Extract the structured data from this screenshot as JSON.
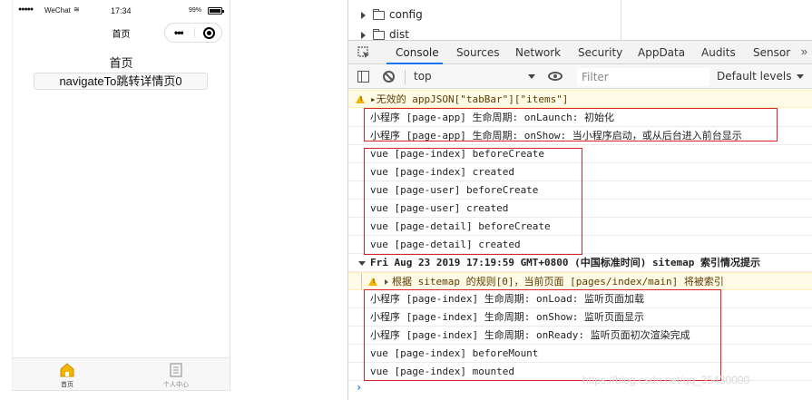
{
  "simulator": {
    "status_bar": {
      "signal": "●●●●●",
      "carrier": "WeChat",
      "wifi": "≋",
      "time": "17:34",
      "battery": "99%"
    },
    "nav_title": "首页",
    "capsule": {
      "more": "•••"
    },
    "page": {
      "title": "首页",
      "button_label": "navigateTo跳转详情页0"
    },
    "tabbar": [
      {
        "label": "首页",
        "icon": "home-icon"
      },
      {
        "label": "个人中心",
        "icon": "document-icon"
      }
    ]
  },
  "devtools": {
    "file_tree": [
      {
        "name": "config"
      },
      {
        "name": "dist"
      }
    ],
    "tabs": [
      "Console",
      "Sources",
      "Network",
      "Security",
      "AppData",
      "Audits",
      "Sensor"
    ],
    "active_tab": "Console",
    "tabs_more": "»",
    "context": "top",
    "filter_placeholder": "Filter",
    "levels_label": "Default levels",
    "accent_color": "#1a73e8",
    "warning_color": "#f2b600",
    "highlight_color": "#d9262b",
    "logs": [
      {
        "type": "warn",
        "text": "▸无效的 appJSON[\"tabBar\"][\"items\"]"
      },
      {
        "type": "log",
        "text": "小程序 [page-app] 生命周期: onLaunch: 初始化"
      },
      {
        "type": "log",
        "text": "小程序 [page-app] 生命周期: onShow: 当小程序启动，或从后台进入前台显示"
      },
      {
        "type": "log",
        "text": "vue [page-index] beforeCreate"
      },
      {
        "type": "log",
        "text": "vue [page-index] created"
      },
      {
        "type": "log",
        "text": "vue [page-user] beforeCreate"
      },
      {
        "type": "log",
        "text": "vue [page-user] created"
      },
      {
        "type": "log",
        "text": "vue [page-detail] beforeCreate"
      },
      {
        "type": "log",
        "text": "vue [page-detail] created"
      },
      {
        "type": "group",
        "text": "Fri Aug 23 2019 17:19:59 GMT+0800 (中国标准时间) sitemap 索引情况提示"
      },
      {
        "type": "warn-nested",
        "text": "根据 sitemap 的规则[0]，当前页面 [pages/index/main] 将被索引"
      },
      {
        "type": "log",
        "text": "小程序 [page-index] 生命周期: onLoad: 监听页面加载"
      },
      {
        "type": "log",
        "text": "小程序 [page-index] 生命周期: onShow: 监听页面显示"
      },
      {
        "type": "log",
        "text": "小程序 [page-index] 生命周期: onReady: 监听页面初次渲染完成"
      },
      {
        "type": "log",
        "text": "vue [page-index] beforeMount"
      },
      {
        "type": "log",
        "text": "vue [page-index] mounted"
      }
    ],
    "prompt": "›",
    "watermark": "https://blog.csdn.net/qq_35430000"
  }
}
